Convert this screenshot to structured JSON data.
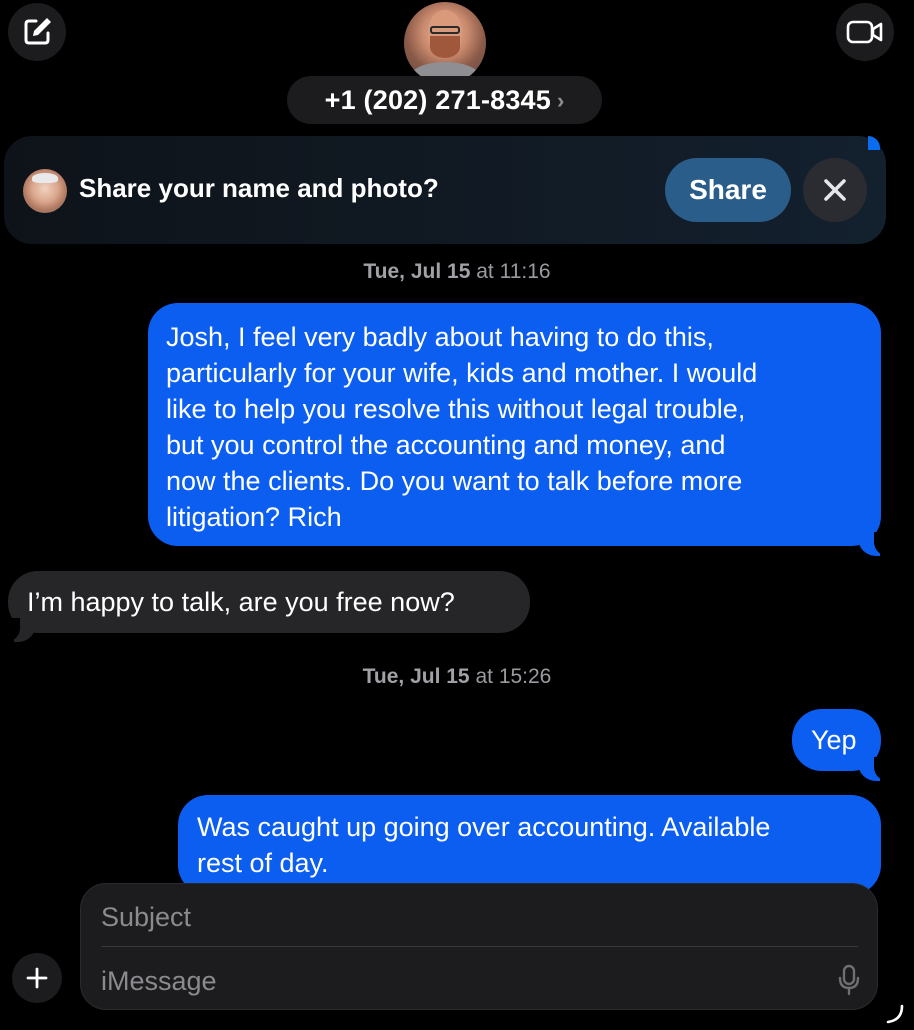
{
  "header": {
    "contact_number": "+1 (202) 271-8345",
    "compose_icon": "compose-icon",
    "video_icon": "video-camera-icon",
    "chevron_icon": "chevron-right-icon"
  },
  "share_banner": {
    "prompt": "Share your name and photo?",
    "share_label": "Share",
    "dismiss_icon": "close-icon"
  },
  "conversation": {
    "timestamps": [
      {
        "day": "Tue, Jul 15",
        "at": "at",
        "time": "11:16"
      },
      {
        "day": "Tue, Jul 15",
        "at": "at",
        "time": "15:26"
      }
    ],
    "messages": [
      {
        "direction": "outgoing",
        "lines": [
          "Josh,  I feel very badly about having to do this,",
          "particularly for your wife, kids and mother.  I would",
          "like to help you resolve this without legal trouble,",
          "but you control the accounting and money, and",
          "now the clients. Do you want to talk before more",
          "litigation? Rich"
        ]
      },
      {
        "direction": "incoming",
        "lines": [
          "I’m happy to talk, are you free now?"
        ]
      },
      {
        "direction": "outgoing",
        "lines": [
          "Yep"
        ]
      },
      {
        "direction": "outgoing",
        "lines": [
          "Was caught up going over accounting. Available",
          "rest of day."
        ]
      }
    ]
  },
  "compose": {
    "subject_placeholder": "Subject",
    "message_placeholder": "iMessage",
    "plus_icon": "plus-icon",
    "mic_icon": "microphone-icon"
  },
  "colors": {
    "background": "#000000",
    "outgoing_bubble": "#0b5ef0",
    "incoming_bubble": "#262629",
    "share_button": "#2b5d8a",
    "secondary_text": "#9a9aa0"
  }
}
